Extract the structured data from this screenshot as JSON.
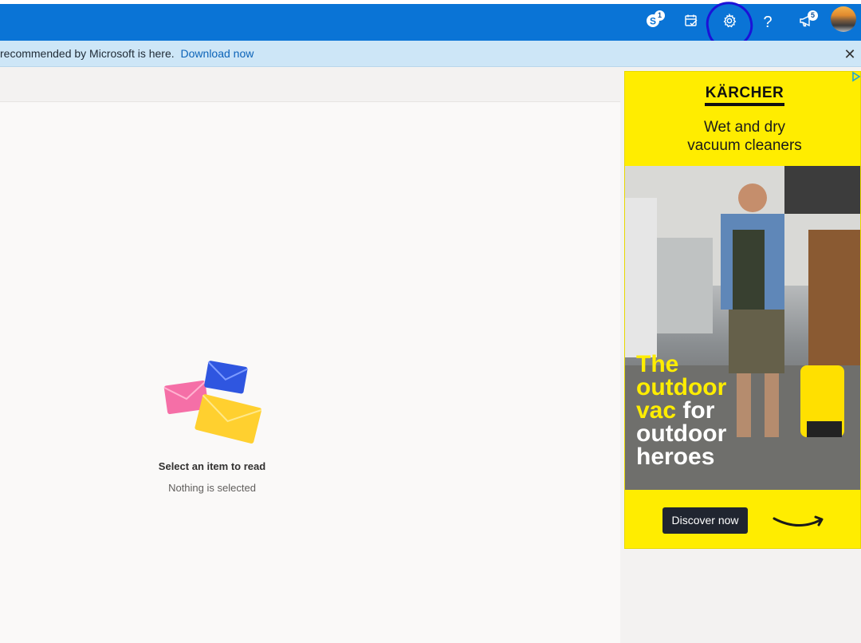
{
  "topbar": {
    "icons": [
      {
        "name": "skype-icon",
        "badge": "1"
      },
      {
        "name": "my-day-icon",
        "badge": ""
      },
      {
        "name": "settings-gear-icon",
        "badge": ""
      },
      {
        "name": "help-icon",
        "badge": ""
      },
      {
        "name": "whats-new-megaphone-icon",
        "badge": "5"
      }
    ],
    "help_glyph": "?",
    "accent_color": "#0a74d6",
    "annotation_color": "#1b12d8"
  },
  "notice": {
    "text": "recommended by Microsoft is here.",
    "link": "Download now",
    "close_glyph": "✕"
  },
  "reading_pane": {
    "title": "Select an item to read",
    "subtitle": "Nothing is selected"
  },
  "ad": {
    "brand": "KÄRCHER",
    "headline_line1": "Wet and dry",
    "headline_line2": "vacuum cleaners",
    "tagline": {
      "line1": "The",
      "line2": "outdoor",
      "line3a": "vac",
      "line3b": " for",
      "line4": "outdoor",
      "line5": "heroes"
    },
    "cta": "Discover now",
    "background_color": "#ffed00"
  }
}
